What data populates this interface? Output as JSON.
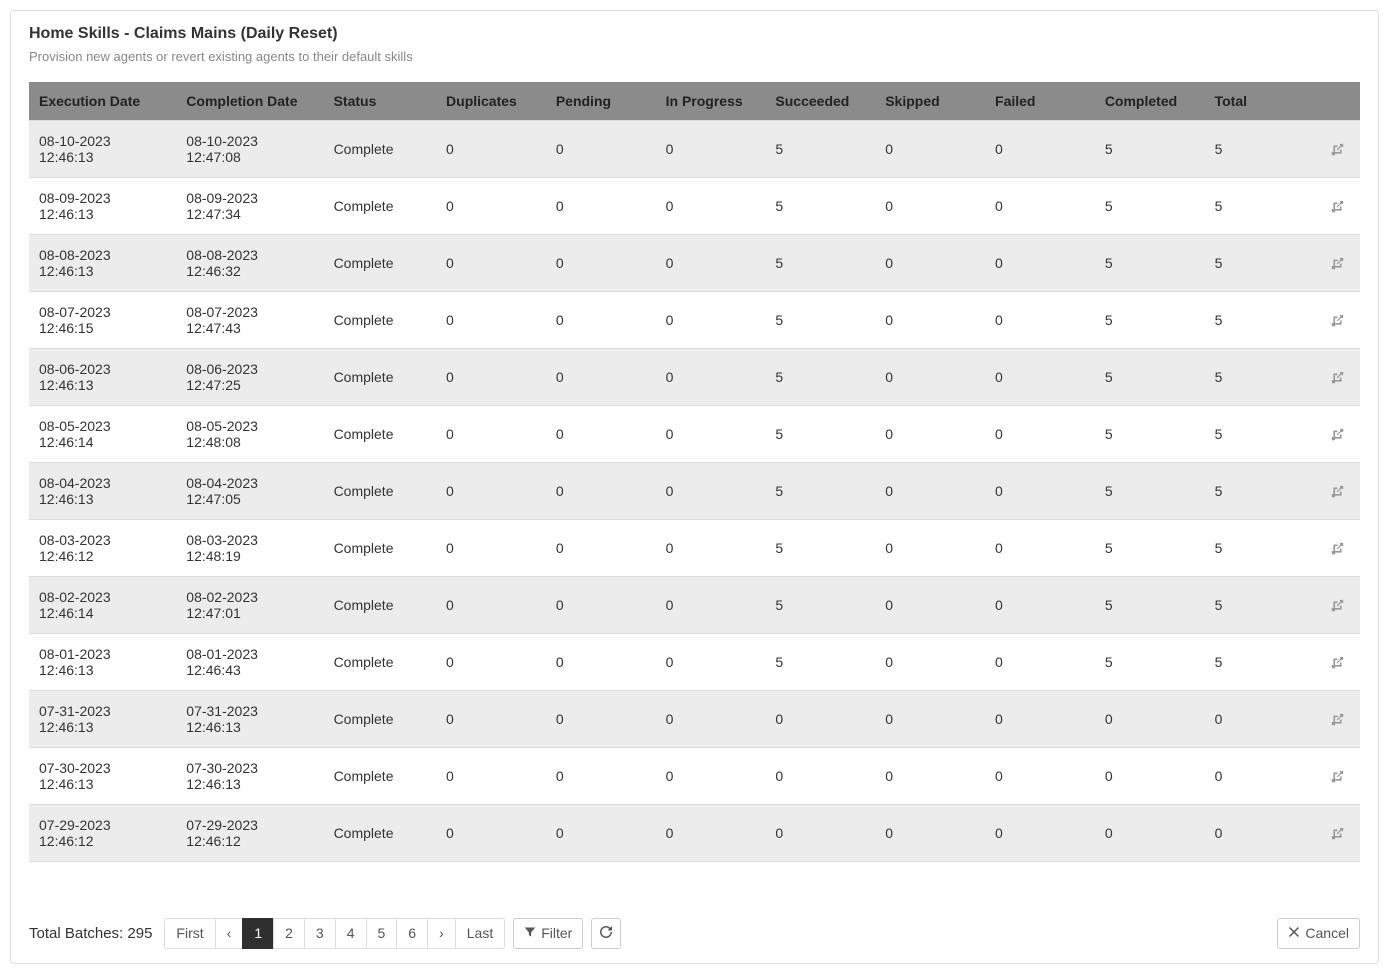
{
  "page": {
    "title": "Home Skills - Claims Mains (Daily Reset)",
    "subtitle": "Provision new agents or revert existing agents to their default skills"
  },
  "table": {
    "headers": {
      "execution_date": "Execution Date",
      "completion_date": "Completion Date",
      "status": "Status",
      "duplicates": "Duplicates",
      "pending": "Pending",
      "in_progress": "In Progress",
      "succeeded": "Succeeded",
      "skipped": "Skipped",
      "failed": "Failed",
      "completed": "Completed",
      "total": "Total"
    },
    "rows": [
      {
        "execution_date": "08-10-2023 12:46:13",
        "completion_date": "08-10-2023 12:47:08",
        "status": "Complete",
        "duplicates": "0",
        "pending": "0",
        "in_progress": "0",
        "succeeded": "5",
        "skipped": "0",
        "failed": "0",
        "completed": "5",
        "total": "5"
      },
      {
        "execution_date": "08-09-2023 12:46:13",
        "completion_date": "08-09-2023 12:47:34",
        "status": "Complete",
        "duplicates": "0",
        "pending": "0",
        "in_progress": "0",
        "succeeded": "5",
        "skipped": "0",
        "failed": "0",
        "completed": "5",
        "total": "5"
      },
      {
        "execution_date": "08-08-2023 12:46:13",
        "completion_date": "08-08-2023 12:46:32",
        "status": "Complete",
        "duplicates": "0",
        "pending": "0",
        "in_progress": "0",
        "succeeded": "5",
        "skipped": "0",
        "failed": "0",
        "completed": "5",
        "total": "5"
      },
      {
        "execution_date": "08-07-2023 12:46:15",
        "completion_date": "08-07-2023 12:47:43",
        "status": "Complete",
        "duplicates": "0",
        "pending": "0",
        "in_progress": "0",
        "succeeded": "5",
        "skipped": "0",
        "failed": "0",
        "completed": "5",
        "total": "5"
      },
      {
        "execution_date": "08-06-2023 12:46:13",
        "completion_date": "08-06-2023 12:47:25",
        "status": "Complete",
        "duplicates": "0",
        "pending": "0",
        "in_progress": "0",
        "succeeded": "5",
        "skipped": "0",
        "failed": "0",
        "completed": "5",
        "total": "5"
      },
      {
        "execution_date": "08-05-2023 12:46:14",
        "completion_date": "08-05-2023 12:48:08",
        "status": "Complete",
        "duplicates": "0",
        "pending": "0",
        "in_progress": "0",
        "succeeded": "5",
        "skipped": "0",
        "failed": "0",
        "completed": "5",
        "total": "5"
      },
      {
        "execution_date": "08-04-2023 12:46:13",
        "completion_date": "08-04-2023 12:47:05",
        "status": "Complete",
        "duplicates": "0",
        "pending": "0",
        "in_progress": "0",
        "succeeded": "5",
        "skipped": "0",
        "failed": "0",
        "completed": "5",
        "total": "5"
      },
      {
        "execution_date": "08-03-2023 12:46:12",
        "completion_date": "08-03-2023 12:48:19",
        "status": "Complete",
        "duplicates": "0",
        "pending": "0",
        "in_progress": "0",
        "succeeded": "5",
        "skipped": "0",
        "failed": "0",
        "completed": "5",
        "total": "5"
      },
      {
        "execution_date": "08-02-2023 12:46:14",
        "completion_date": "08-02-2023 12:47:01",
        "status": "Complete",
        "duplicates": "0",
        "pending": "0",
        "in_progress": "0",
        "succeeded": "5",
        "skipped": "0",
        "failed": "0",
        "completed": "5",
        "total": "5"
      },
      {
        "execution_date": "08-01-2023 12:46:13",
        "completion_date": "08-01-2023 12:46:43",
        "status": "Complete",
        "duplicates": "0",
        "pending": "0",
        "in_progress": "0",
        "succeeded": "5",
        "skipped": "0",
        "failed": "0",
        "completed": "5",
        "total": "5"
      },
      {
        "execution_date": "07-31-2023 12:46:13",
        "completion_date": "07-31-2023 12:46:13",
        "status": "Complete",
        "duplicates": "0",
        "pending": "0",
        "in_progress": "0",
        "succeeded": "0",
        "skipped": "0",
        "failed": "0",
        "completed": "0",
        "total": "0"
      },
      {
        "execution_date": "07-30-2023 12:46:13",
        "completion_date": "07-30-2023 12:46:13",
        "status": "Complete",
        "duplicates": "0",
        "pending": "0",
        "in_progress": "0",
        "succeeded": "0",
        "skipped": "0",
        "failed": "0",
        "completed": "0",
        "total": "0"
      },
      {
        "execution_date": "07-29-2023 12:46:12",
        "completion_date": "07-29-2023 12:46:12",
        "status": "Complete",
        "duplicates": "0",
        "pending": "0",
        "in_progress": "0",
        "succeeded": "0",
        "skipped": "0",
        "failed": "0",
        "completed": "0",
        "total": "0"
      }
    ]
  },
  "footer": {
    "total_label": "Total Batches:",
    "total_value": "295",
    "pagination": {
      "first": "First",
      "prev": "‹",
      "pages": [
        "1",
        "2",
        "3",
        "4",
        "5",
        "6"
      ],
      "active_index": 0,
      "next": "›",
      "last": "Last"
    },
    "filter_label": "Filter",
    "cancel_label": "Cancel"
  }
}
